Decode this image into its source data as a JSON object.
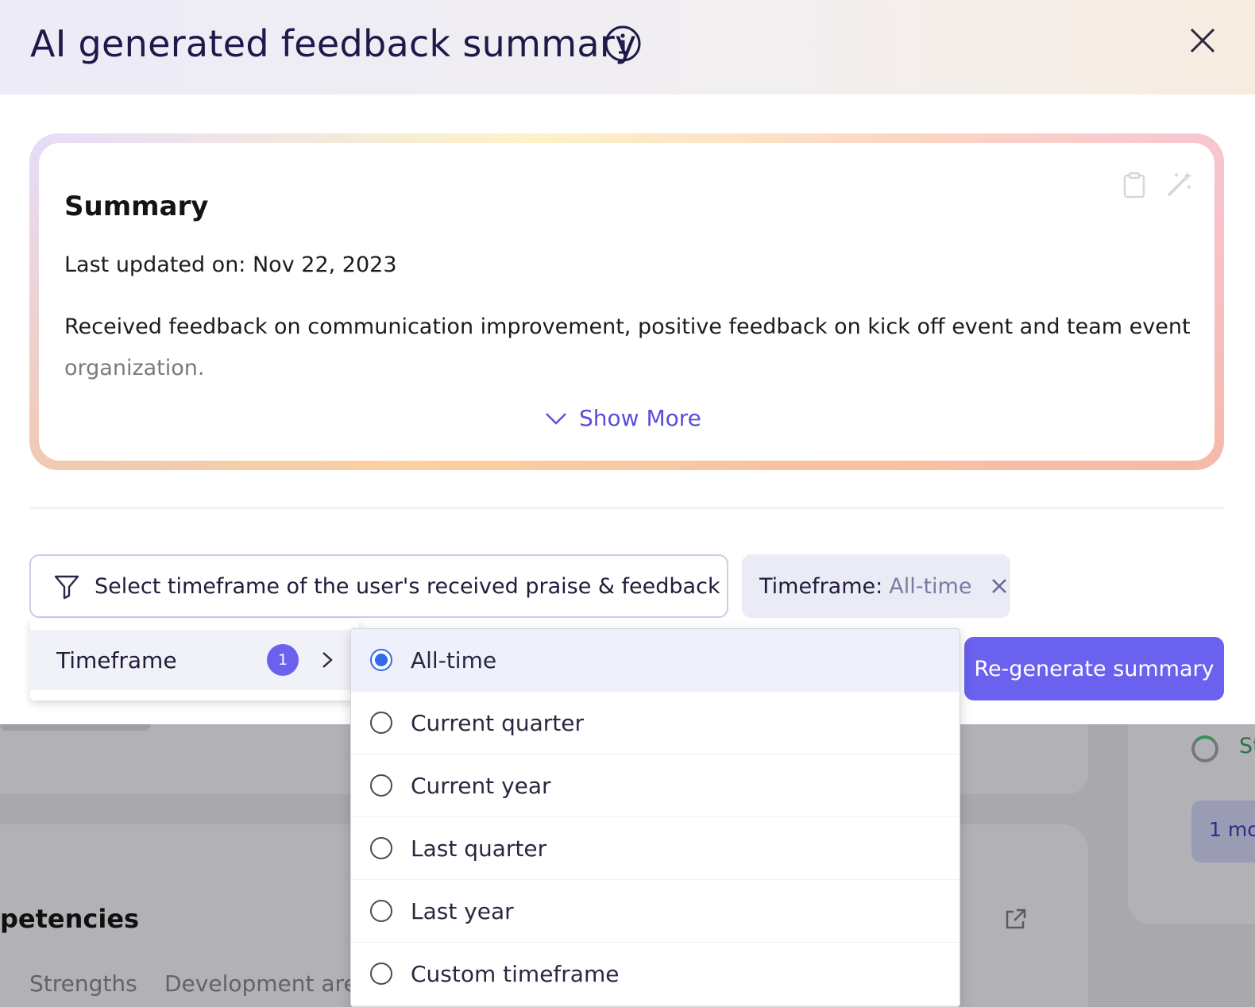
{
  "modal": {
    "title": "AI generated feedback summary",
    "colors": {
      "accent": "#6a61ee",
      "radio_selected": "#2f6bea"
    }
  },
  "summary": {
    "title": "Summary",
    "last_updated": "Last updated on: Nov 22, 2023",
    "text_line1": "Received feedback on communication improvement, positive feedback on kick off event and team event",
    "text_line2": "organization.",
    "show_more": "Show More"
  },
  "filter": {
    "label": "Select timeframe of the user's received praise & feedback",
    "chip_key": "Timeframe:",
    "chip_value": "All-time",
    "regenerate": "Re-generate summary"
  },
  "menu": {
    "category": "Timeframe",
    "badge": "1",
    "options": [
      {
        "label": "All-time",
        "selected": true
      },
      {
        "label": "Current quarter",
        "selected": false
      },
      {
        "label": "Current year",
        "selected": false
      },
      {
        "label": "Last quarter",
        "selected": false
      },
      {
        "label": "Last year",
        "selected": false
      },
      {
        "label": "Custom timeframe",
        "selected": false
      }
    ]
  },
  "background": {
    "section_title": "petencies",
    "tab1": "Strengths",
    "tab2": "Development are",
    "status_fragment": "St",
    "pill_fragment": "1 mo"
  }
}
